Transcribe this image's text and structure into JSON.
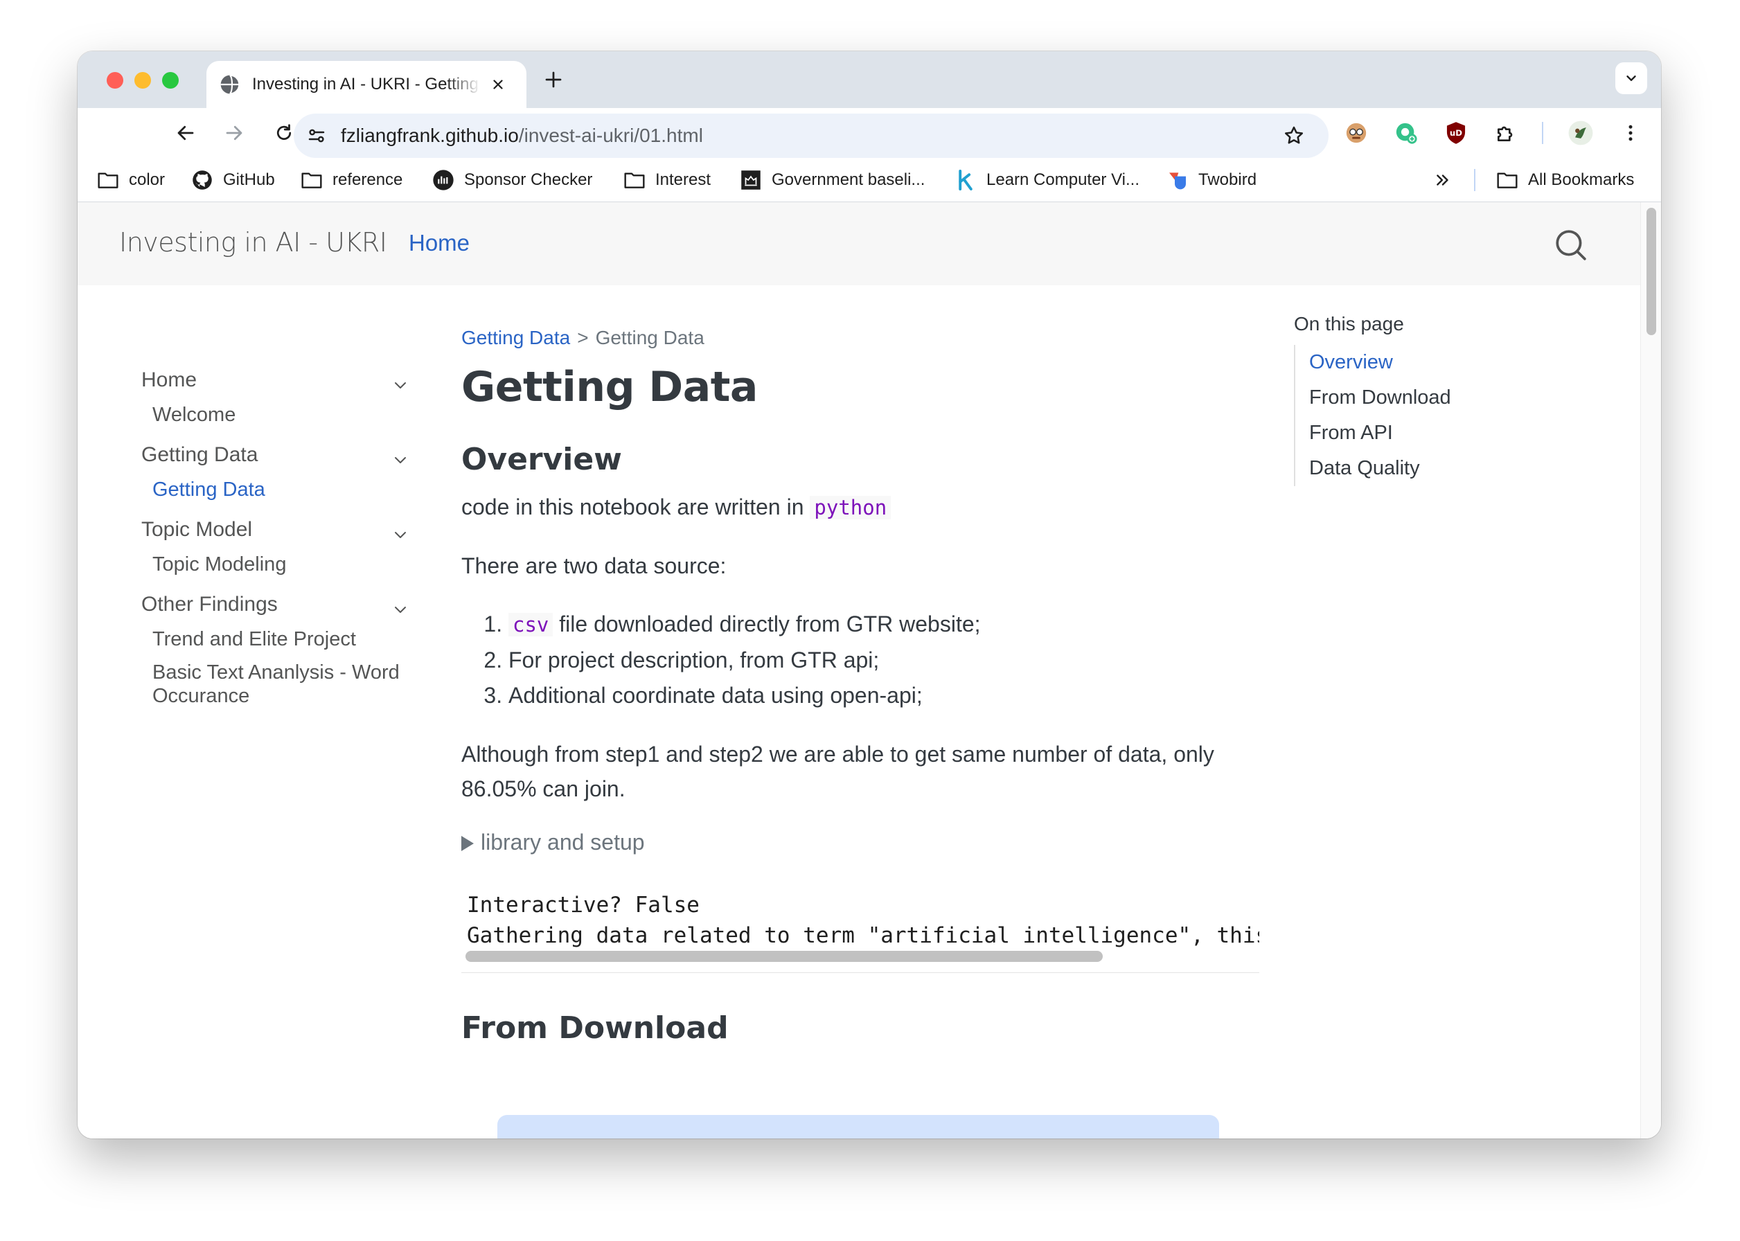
{
  "browser": {
    "tab_title": "Investing in AI - UKRI - Getting Data",
    "url_host": "fzliangfrank.github.io",
    "url_path": "/invest-ai-ukri/01.html",
    "traffic_lights": [
      "#ff5f57",
      "#febc2e",
      "#28c840"
    ],
    "bookmarks": [
      {
        "label": "color",
        "icon": "folder-icon"
      },
      {
        "label": "GitHub",
        "icon": "github-icon"
      },
      {
        "label": "reference",
        "icon": "folder-icon"
      },
      {
        "label": "Sponsor Checker",
        "icon": "sponsor-icon"
      },
      {
        "label": "Interest",
        "icon": "folder-icon"
      },
      {
        "label": "Government baseli...",
        "icon": "gov-crest-icon"
      },
      {
        "label": "Learn Computer Vi...",
        "icon": "k-icon"
      },
      {
        "label": "Twobird",
        "icon": "twobird-icon"
      }
    ],
    "all_bookmarks": "All Bookmarks"
  },
  "site": {
    "title": "Investing in AI - UKRI",
    "nav_home": "Home",
    "accent_color": "#2a64c5"
  },
  "sidebar": {
    "sections": [
      {
        "label": "Home",
        "items": [
          "Welcome"
        ]
      },
      {
        "label": "Getting Data",
        "items": [
          "Getting Data"
        ]
      },
      {
        "label": "Topic Model",
        "items": [
          "Topic Modeling"
        ]
      },
      {
        "label": "Other Findings",
        "items": [
          "Trend and Elite Project",
          "Basic Text Ananlysis - Word Occurance"
        ]
      }
    ]
  },
  "breadcrumb": {
    "parent": "Getting Data",
    "sep": ">",
    "current": "Getting Data"
  },
  "main": {
    "title": "Getting Data",
    "overview_heading": "Overview",
    "intro_prefix": "code in this notebook are written in",
    "intro_code": "python",
    "sources_text": "There are two data source:",
    "step1_code": "csv",
    "step1_text": "file downloaded directly from GTR website;",
    "step2": "For project description, from GTR api;",
    "step3": "Additional coordinate data using open-api;",
    "join_text": "Although from step1 and step2 we are able to get same number of data, only 86.05% can join.",
    "details_label": "library and setup",
    "output_lines": [
      "Interactive? False",
      "Gathering data related to term \"artificial intelligence\", this h"
    ],
    "download_heading": "From Download"
  },
  "toc": {
    "title": "On this page",
    "items": [
      "Overview",
      "From Download",
      "From API",
      "Data Quality"
    ],
    "active": "Overview"
  }
}
